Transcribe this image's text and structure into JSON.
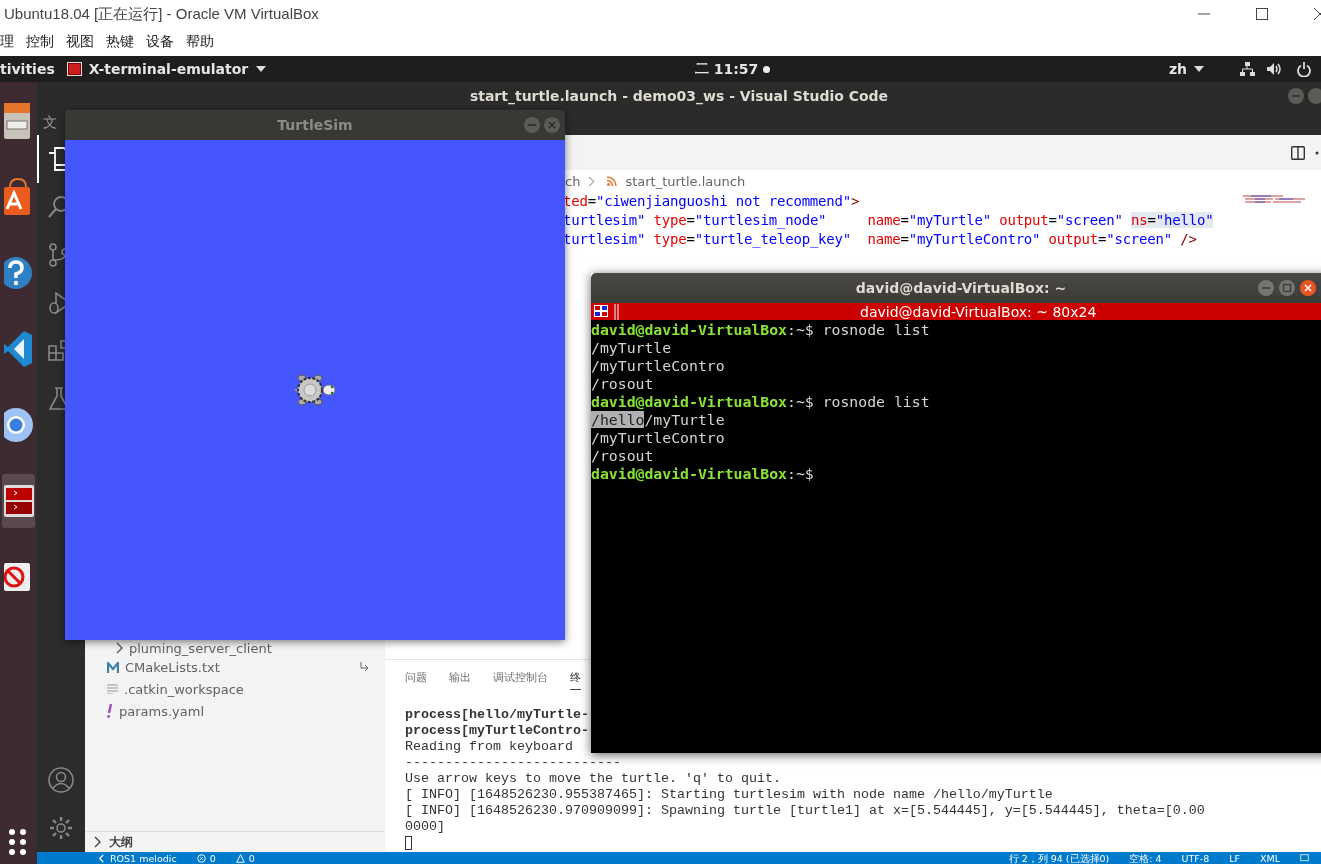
{
  "host_window": {
    "title": "Ubuntu18.04 [正在运行] - Oracle VM VirtualBox",
    "menu": [
      "理",
      "控制",
      "视图",
      "热键",
      "设备",
      "帮助"
    ]
  },
  "top_bar": {
    "activities": "tivities",
    "app_menu": "X-terminal-emulator",
    "clock_day": "二",
    "clock_time": "11:57",
    "input_method": "zh"
  },
  "dock": {
    "items": [
      {
        "kind": "files",
        "selected": false
      },
      {
        "kind": "software",
        "selected": false
      },
      {
        "kind": "help",
        "selected": false
      },
      {
        "kind": "code",
        "selected": false
      },
      {
        "kind": "browser",
        "selected": false
      },
      {
        "kind": "terminal",
        "selected": true
      },
      {
        "kind": "blocked",
        "selected": false
      }
    ]
  },
  "vscode": {
    "title": "start_turtle.launch - demo03_ws - Visual Studio Code",
    "menu": [
      "文"
    ],
    "activity": [
      {
        "kind": "explorer",
        "selected": true
      },
      {
        "kind": "search",
        "selected": false
      },
      {
        "kind": "git",
        "selected": false
      },
      {
        "kind": "debug",
        "selected": false
      },
      {
        "kind": "extensions",
        "selected": false
      },
      {
        "kind": "test",
        "selected": false
      }
    ],
    "breadcrumb": [
      "ch",
      "start_turtle.launch"
    ],
    "code_lines": [
      {
        "tokens": [
          {
            "text": "ted",
            "kind": "attr"
          },
          {
            "text": "=",
            "kind": "punct"
          },
          {
            "text": "\"ciwenjianguoshi not recommend\"",
            "kind": "value"
          },
          {
            "text": ">",
            "kind": "tag"
          }
        ]
      },
      {
        "tokens": [
          {
            "text": "turtlesim\"",
            "kind": "value"
          },
          {
            "text": " type",
            "kind": "attr"
          },
          {
            "text": "=",
            "kind": "punct"
          },
          {
            "text": "\"turtlesim_node\"",
            "kind": "value"
          },
          {
            "text": "     name",
            "kind": "attr"
          },
          {
            "text": "=",
            "kind": "punct"
          },
          {
            "text": "\"myTurtle\"",
            "kind": "value"
          },
          {
            "text": " output",
            "kind": "attr"
          },
          {
            "text": "=",
            "kind": "punct"
          },
          {
            "text": "\"screen\"",
            "kind": "value"
          }
        ],
        "selected_tokens": [
          {
            "text": "ns",
            "kind": "attr"
          },
          {
            "text": "=",
            "kind": "punct"
          },
          {
            "text": "\"hello\"",
            "kind": "value"
          }
        ]
      },
      {
        "tokens": [
          {
            "text": "turtlesim\"",
            "kind": "value"
          },
          {
            "text": " type",
            "kind": "attr"
          },
          {
            "text": "=",
            "kind": "punct"
          },
          {
            "text": "\"turtle_teleop_key\"",
            "kind": "value"
          },
          {
            "text": "  name",
            "kind": "attr"
          },
          {
            "text": "=",
            "kind": "punct"
          },
          {
            "text": "\"myTurtleContro\"",
            "kind": "value"
          },
          {
            "text": " output",
            "kind": "attr"
          },
          {
            "text": "=",
            "kind": "punct"
          },
          {
            "text": "\"screen\"",
            "kind": "value"
          },
          {
            "text": " />",
            "kind": "tag"
          }
        ]
      }
    ],
    "explorer": [
      {
        "kind": "folder",
        "name": "pluming_server_client",
        "expanded": false
      },
      {
        "kind": "cmake",
        "name": "CMakeLists.txt",
        "symlink": true
      },
      {
        "kind": "file",
        "name": ".catkin_workspace"
      },
      {
        "kind": "yaml",
        "name": "params.yaml"
      }
    ],
    "outline": {
      "label": "大纲",
      "expanded": false
    },
    "panel_tabs": [
      {
        "label": "问题",
        "selected": false
      },
      {
        "label": "输出",
        "selected": false
      },
      {
        "label": "调试控制台",
        "selected": false
      },
      {
        "label": "终",
        "selected": true
      }
    ],
    "terminal_lines": [
      {
        "text": "process[hello/myTurtle-",
        "bold": true
      },
      {
        "text": "process[myTurtleContro-",
        "bold": true
      },
      {
        "text": "Reading from keyboard",
        "bold": false
      },
      {
        "text": "---------------------------",
        "bold": false
      },
      {
        "text": "Use arrow keys to move the turtle. 'q' to quit.",
        "bold": false
      },
      {
        "text": "[ INFO] [1648526230.955387465]: Starting turtlesim with node name /hello/myTurtle",
        "bold": false
      },
      {
        "text": "[ INFO] [1648526230.970909099]: Spawning turtle [turtle1] at x=[5.544445], y=[5.544445], theta=[0.00",
        "bold": false
      },
      {
        "text": "0000]",
        "bold": false
      }
    ],
    "status_left": [
      {
        "kind": "remote",
        "text": "ROS1 melodic"
      },
      {
        "kind": "errors",
        "text": "0"
      },
      {
        "kind": "warnings",
        "text": "0"
      }
    ],
    "status_right": [
      "行 2，列 94 (已选择0)",
      "空格: 4",
      "UTF-8",
      "LF",
      "XML"
    ]
  },
  "turtlesim": {
    "title": "TurtleSim"
  },
  "terminal": {
    "title": "david@david-VirtualBox: ~",
    "header": "david@david-VirtualBox: ~ 80x24",
    "lines": [
      {
        "kind": "prompt",
        "user": "david@david-VirtualBox",
        "path": ":~$",
        "command": "rosnode list"
      },
      {
        "kind": "output",
        "segments": [
          {
            "text": "/myTurtle",
            "selected": false
          }
        ]
      },
      {
        "kind": "output",
        "segments": [
          {
            "text": "/myTurtleContro",
            "selected": false
          }
        ]
      },
      {
        "kind": "output",
        "segments": [
          {
            "text": "/rosout",
            "selected": false
          }
        ]
      },
      {
        "kind": "prompt",
        "user": "david@david-VirtualBox",
        "path": ":~$",
        "command": "rosnode list"
      },
      {
        "kind": "output",
        "segments": [
          {
            "text": "/hello",
            "selected": true
          },
          {
            "text": "/myTurtle",
            "selected": false
          }
        ]
      },
      {
        "kind": "output",
        "segments": [
          {
            "text": "/myTurtleContro",
            "selected": false
          }
        ]
      },
      {
        "kind": "output",
        "segments": [
          {
            "text": "/rosout",
            "selected": false
          }
        ]
      },
      {
        "kind": "prompt",
        "user": "david@david-VirtualBox",
        "path": ":~$"
      }
    ]
  }
}
